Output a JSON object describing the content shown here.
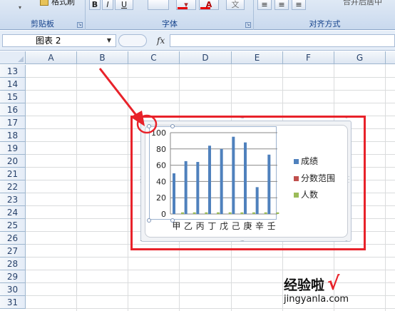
{
  "ribbon": {
    "clipboard": {
      "label": "剪贴板",
      "format_painter": "格式刷"
    },
    "font": {
      "label": "字体",
      "bold": "B",
      "italic": "I",
      "underline": "U",
      "font_color_glyph": "A",
      "phonetic": "文"
    },
    "alignment": {
      "label": "对齐方式",
      "merge_center": "合并后居中"
    }
  },
  "formula_bar": {
    "name_box": "图表 2",
    "fx": "fx",
    "formula": ""
  },
  "sheet": {
    "columns": [
      "A",
      "B",
      "C",
      "D",
      "E",
      "F",
      "G"
    ],
    "rows": [
      "13",
      "14",
      "15",
      "16",
      "17",
      "18",
      "19",
      "20",
      "21",
      "22",
      "23",
      "24",
      "25",
      "26",
      "27",
      "28",
      "29",
      "30",
      "31"
    ]
  },
  "chart_data": {
    "type": "bar",
    "categories": [
      "甲",
      "乙",
      "丙",
      "丁",
      "戊",
      "己",
      "庚",
      "辛",
      "壬"
    ],
    "series": [
      {
        "name": "成绩",
        "color": "#4f81bd",
        "values": [
          50,
          65,
          64,
          84,
          80,
          95,
          88,
          33,
          73
        ]
      },
      {
        "name": "分数范围",
        "color": "#c0504d",
        "values": [
          0,
          0,
          0,
          0,
          0,
          0,
          0,
          0,
          0
        ]
      },
      {
        "name": "人数",
        "color": "#9bbb59",
        "values": [
          2,
          2,
          2,
          2,
          2,
          2,
          2,
          2,
          2
        ]
      }
    ],
    "ylim": [
      0,
      100
    ],
    "yticks": [
      "0",
      "20",
      "40",
      "60",
      "80",
      "100"
    ],
    "grid": true,
    "legend": "right",
    "title": "",
    "xlabel": "",
    "ylabel": ""
  },
  "annotation": {
    "color": "#e8222a"
  },
  "watermark": {
    "line1": "经验啦",
    "check": "√",
    "line2": "jingyanla.com"
  }
}
